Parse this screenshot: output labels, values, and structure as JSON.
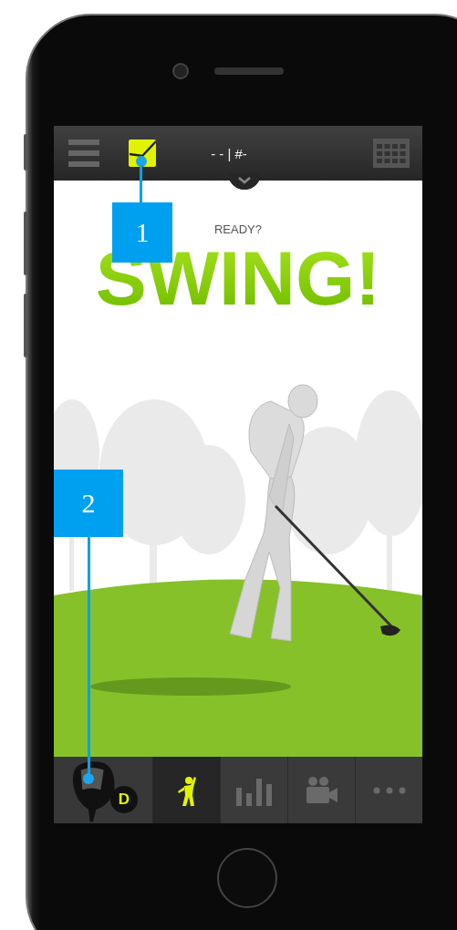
{
  "top_bar": {
    "score": "- - | #-"
  },
  "prompt": "READY?",
  "headline": "SWING!",
  "club": {
    "badge": "D"
  },
  "tabs": [
    {
      "kind": "swing",
      "selected": true
    },
    {
      "kind": "stats",
      "selected": false
    },
    {
      "kind": "video",
      "selected": false
    },
    {
      "kind": "more",
      "selected": false
    }
  ],
  "callouts": [
    {
      "number": "1"
    },
    {
      "number": "2"
    }
  ]
}
